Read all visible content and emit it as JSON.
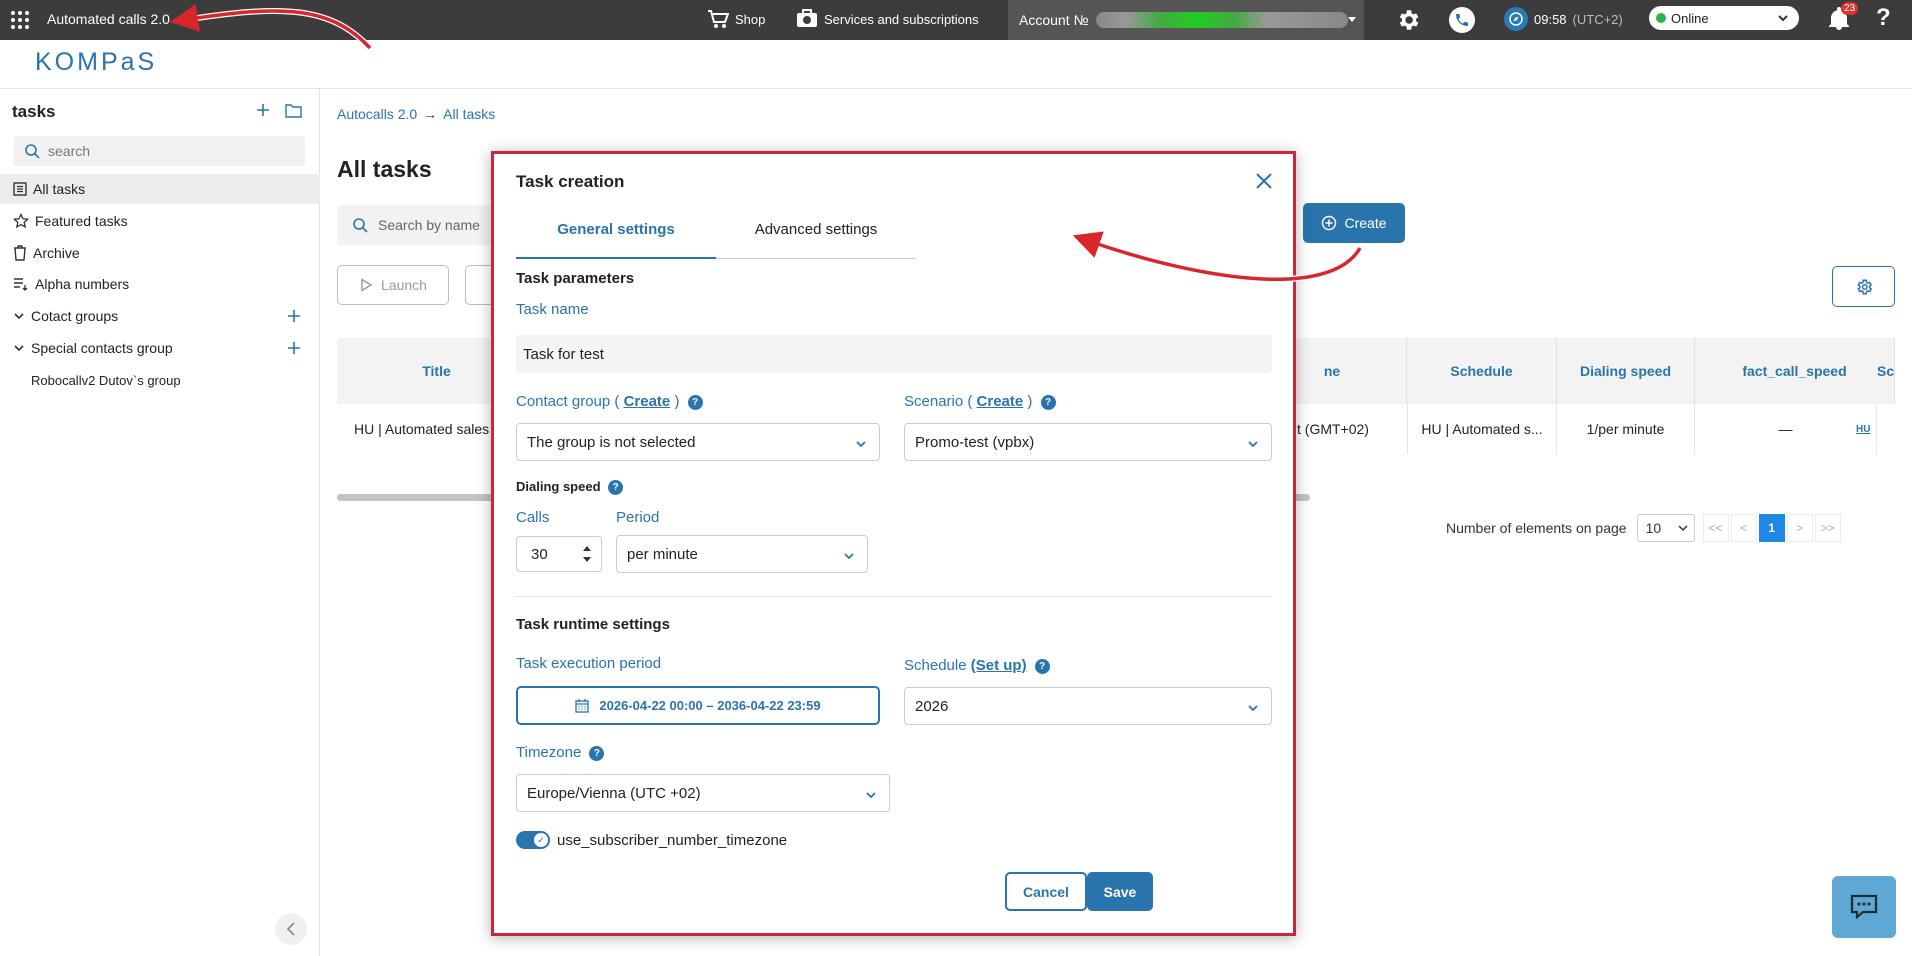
{
  "topbar": {
    "app_title": "Automated calls 2.0",
    "shop_label": "Shop",
    "services_label": "Services and subscriptions",
    "account_label": "Account №",
    "time": "09:58",
    "utc": "(UTC+2)",
    "status": "Online",
    "notifications_count": "23",
    "help": "?"
  },
  "logo": "KOMPaS",
  "sidebar": {
    "title": "tasks",
    "search_placeholder": "search",
    "items": [
      {
        "label": "All tasks"
      },
      {
        "label": "Featured tasks"
      },
      {
        "label": "Archive"
      },
      {
        "label": "Alpha numbers"
      },
      {
        "label": "Cotact groups"
      },
      {
        "label": "Special contacts group"
      },
      {
        "label": "Robocallv2 Dutov`s group"
      }
    ]
  },
  "main": {
    "breadcrumb": [
      "Autocalls 2.0",
      "→",
      "All tasks"
    ],
    "title": "All tasks",
    "search_placeholder": "Search by name",
    "launch_label": "Launch",
    "create_label": "Create",
    "table": {
      "headers": [
        "Title",
        "ne",
        "Schedule",
        "Dialing speed",
        "fact_call_speed",
        "Sc"
      ],
      "row": [
        "HU | Automated sales",
        "t (GMT+02)",
        "HU | Automated s...",
        "1/per minute",
        "—",
        "HU"
      ]
    },
    "pager": {
      "label": "Number of elements on page",
      "per_page": "10",
      "first": "<<",
      "prev": "<",
      "current": "1",
      "next": ">",
      "last": ">>"
    }
  },
  "modal": {
    "title": "Task creation",
    "tabs": [
      "General settings",
      "Advanced settings"
    ],
    "section_params": "Task parameters",
    "task_name_label": "Task name",
    "task_name_value": "Task for test",
    "contact_group_label": "Contact group (",
    "contact_group_link": "Create",
    "contact_group_close": ")",
    "contact_group_value": "The group is not selected",
    "scenario_label": "Scenario (",
    "scenario_link": "Create",
    "scenario_close": ")",
    "scenario_value": "Promo-test (vpbx)",
    "dialing_speed_label": "Dialing speed",
    "calls_label": "Calls",
    "calls_value": "30",
    "period_label": "Period",
    "period_value": "per minute",
    "section_runtime": "Task runtime settings",
    "execution_period_label": "Task execution period",
    "execution_period_value": "2026-04-22 00:00 – 2036-04-22 23:59",
    "schedule_label": "Schedule",
    "schedule_link": "(Set up)",
    "schedule_value": "2026",
    "timezone_label": "Timezone",
    "timezone_value": "Europe/Vienna (UTC +02)",
    "toggle_label": "use_subscriber_number_timezone",
    "toggle_on": true,
    "cancel_label": "Cancel",
    "save_label": "Save"
  },
  "colors": {
    "accent": "#2a74ae",
    "topbar": "#3c3c3c",
    "highlight_border": "#c8283c",
    "annotation_arrow": "#d8262b"
  }
}
